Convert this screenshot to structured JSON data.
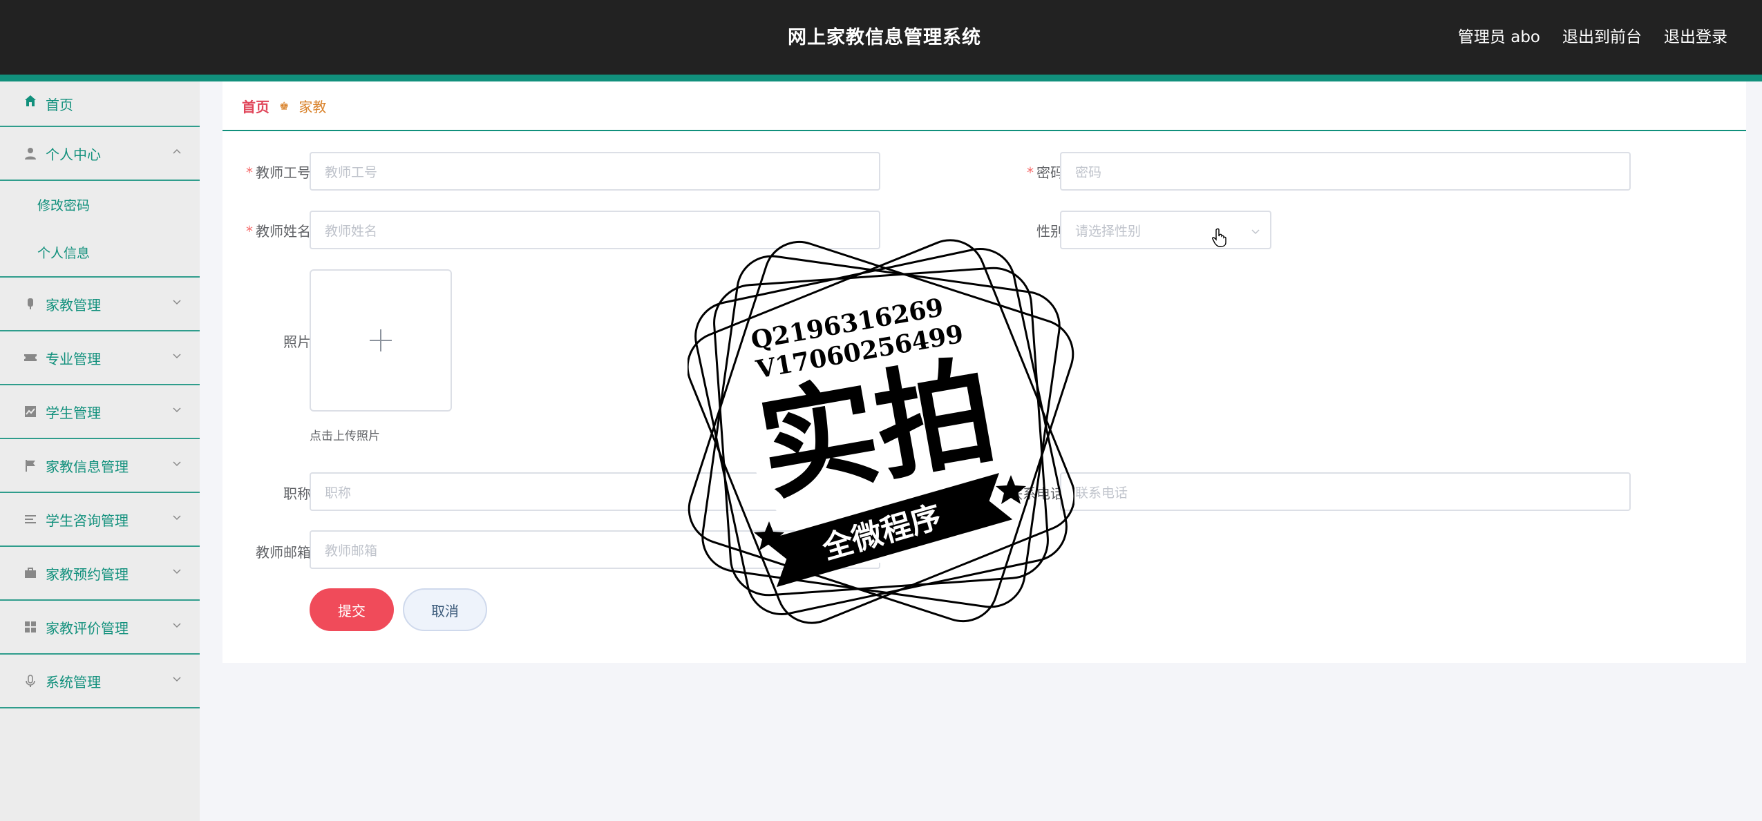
{
  "header": {
    "title": "网上家教信息管理系统",
    "user": "管理员 abo",
    "to_front": "退出到前台",
    "logout": "退出登录"
  },
  "sidebar": {
    "home": "首页",
    "personal_center": "个人中心",
    "change_password": "修改密码",
    "personal_info": "个人信息",
    "items": [
      {
        "label": "家教管理",
        "icon": "tutor-icon"
      },
      {
        "label": "专业管理",
        "icon": "ticket-icon"
      },
      {
        "label": "学生管理",
        "icon": "chart-icon"
      },
      {
        "label": "家教信息管理",
        "icon": "flag-icon"
      },
      {
        "label": "学生咨询管理",
        "icon": "list-icon"
      },
      {
        "label": "家教预约管理",
        "icon": "briefcase-icon"
      },
      {
        "label": "家教评价管理",
        "icon": "grid-icon"
      },
      {
        "label": "系统管理",
        "icon": "microphone-icon"
      }
    ]
  },
  "breadcrumb": {
    "home": "首页",
    "current": "家教"
  },
  "form": {
    "teacher_id_label": "教师工号",
    "teacher_id_placeholder": "教师工号",
    "password_label": "密码",
    "password_placeholder": "密码",
    "teacher_name_label": "教师姓名",
    "teacher_name_placeholder": "教师姓名",
    "gender_label": "性别",
    "gender_placeholder": "请选择性别",
    "photo_label": "照片",
    "photo_tip": "点击上传照片",
    "title_label": "职称",
    "title_placeholder": "职称",
    "phone_label": "联系电话",
    "phone_placeholder": "联系电话",
    "email_label": "教师邮箱",
    "email_placeholder": "教师邮箱",
    "submit": "提交",
    "cancel": "取消"
  },
  "watermark": {
    "line1": "Q2196316269",
    "line2": "V17060256499",
    "big": "实拍",
    "banner": "全微程序"
  }
}
